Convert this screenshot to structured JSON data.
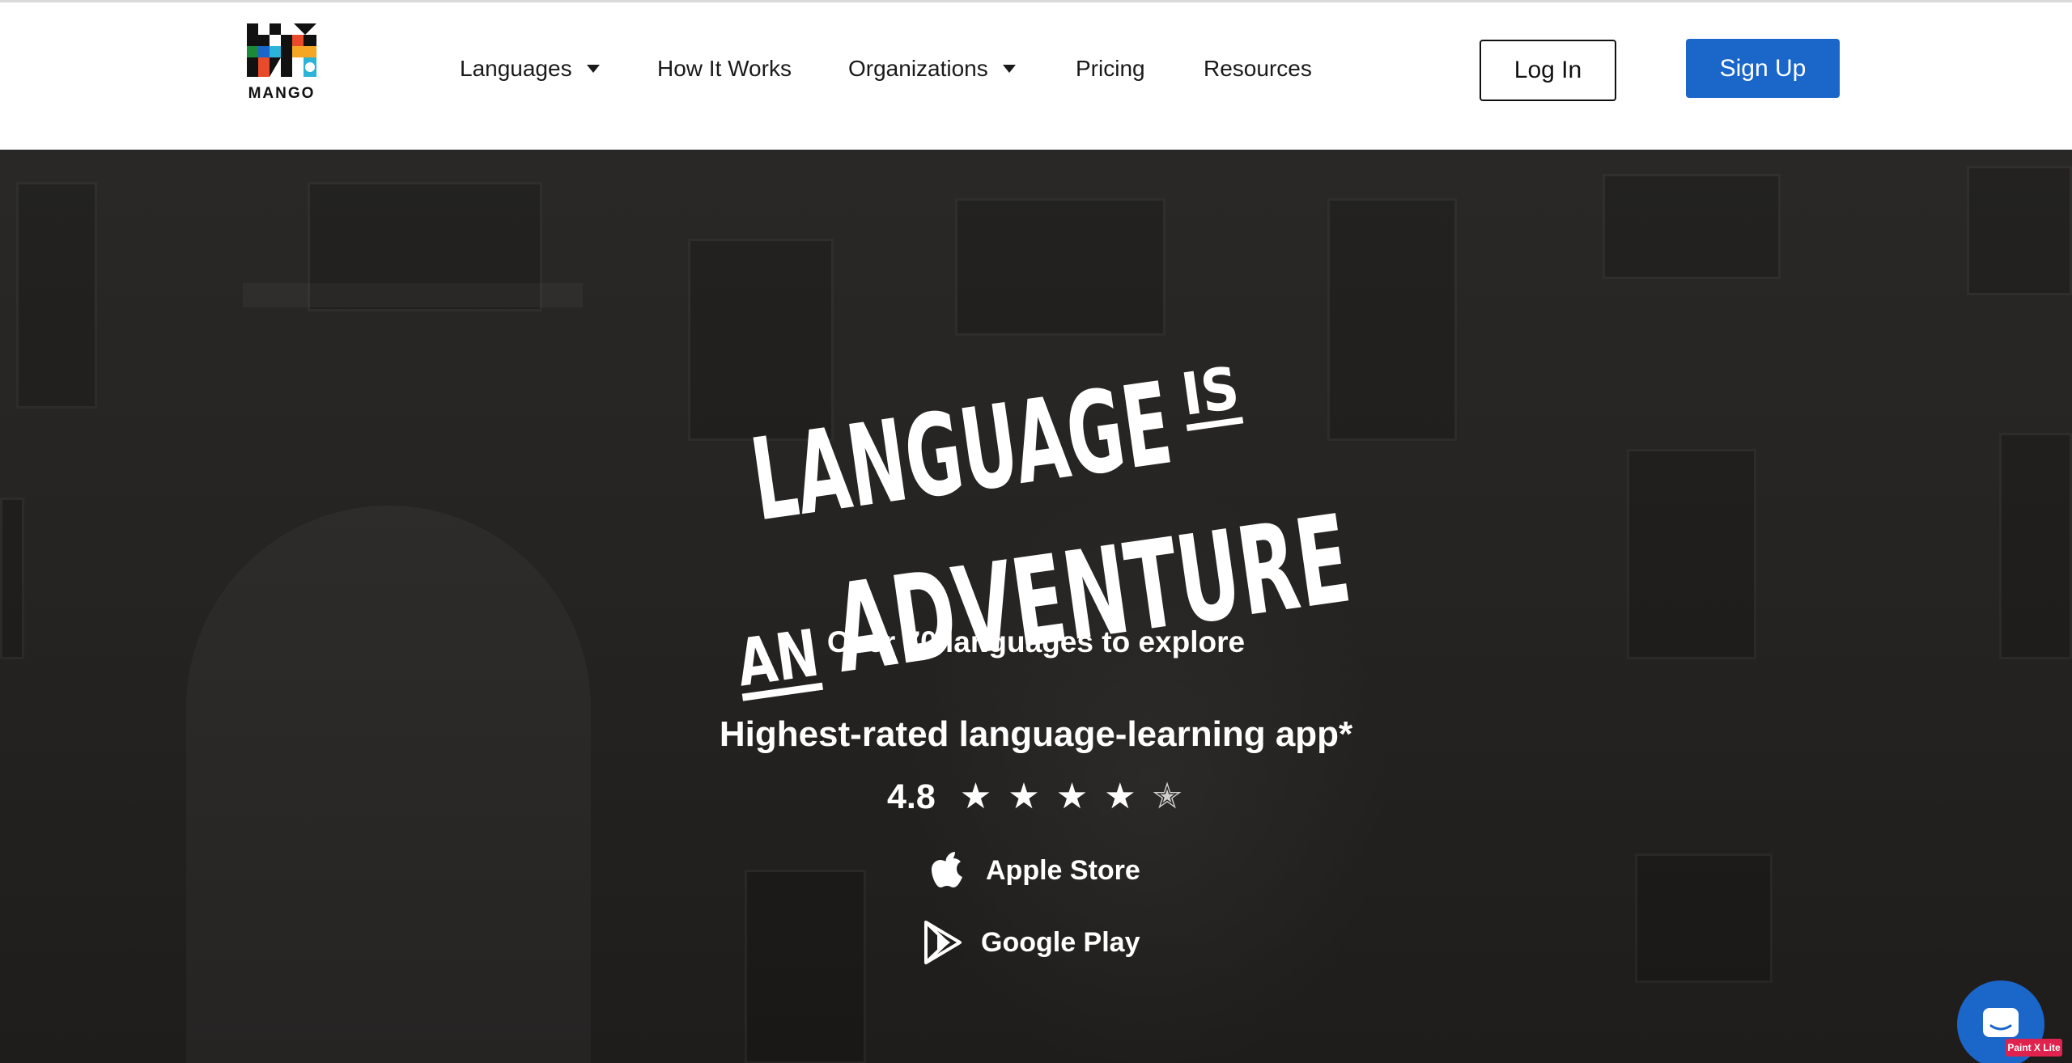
{
  "brand": {
    "logo_text": "MANGO"
  },
  "nav": {
    "items": [
      {
        "label": "Languages",
        "dropdown": true
      },
      {
        "label": "How It Works",
        "dropdown": false
      },
      {
        "label": "Organizations",
        "dropdown": true
      },
      {
        "label": "Pricing",
        "dropdown": false
      },
      {
        "label": "Resources",
        "dropdown": false
      }
    ],
    "login_label": "Log In",
    "signup_label": "Sign Up"
  },
  "hero": {
    "headline_line1": "LANGUAGE",
    "headline_is": "IS",
    "headline_an": "AN",
    "headline_line2": "ADVENTURE",
    "explore_text": "Over 70 languages to explore",
    "rated_text": "Highest-rated language-learning app*",
    "rating": "4.8",
    "rating_value": 4.8,
    "stars_max": 5,
    "stores": [
      {
        "label": "Apple Store",
        "icon": "apple-icon"
      },
      {
        "label": "Google Play",
        "icon": "google-play-icon"
      }
    ]
  },
  "widgets": {
    "chat_icon": "chat-icon",
    "badge_text": "Paint X Lite"
  },
  "colors": {
    "accent": "#1a66c9",
    "hero_bg": "#262422",
    "text_dark": "#1a1a1a",
    "badge": "#e0234e"
  }
}
